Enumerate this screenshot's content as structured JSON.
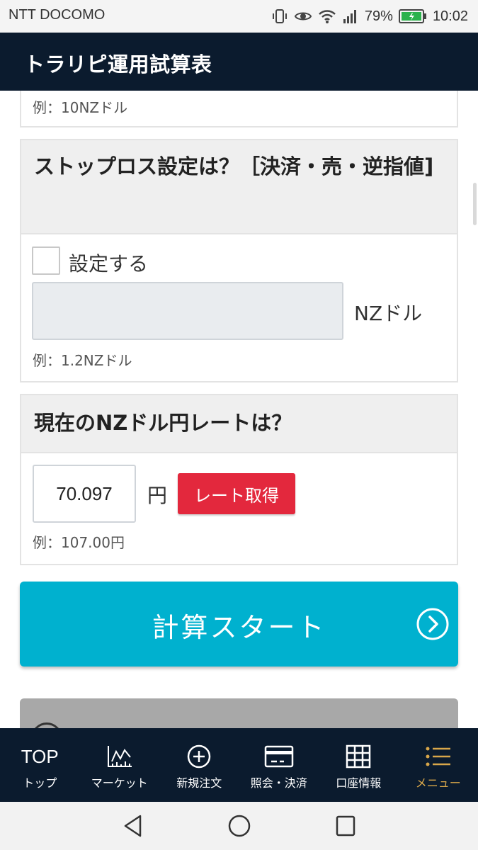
{
  "status_bar": {
    "carrier": "NTT DOCOMO",
    "battery_percent": "79%",
    "time": "10:02",
    "icons": [
      "vibrate-icon",
      "eye-icon",
      "wifi-icon",
      "signal-icon",
      "battery-icon"
    ]
  },
  "header": {
    "title": "トラリピ運用試算表"
  },
  "prev_card": {
    "hint": "例：10NZドル"
  },
  "stop_loss": {
    "title": "ストップロス設定は？［決済・売・逆指値]",
    "checkbox_label": "設定する",
    "checkbox_checked": false,
    "input_value": "",
    "unit": "NZドル",
    "hint": "例：1.2NZドル"
  },
  "rate": {
    "title": "現在のNZドル円レートは？",
    "input_value": "70.097",
    "unit": "円",
    "button_label": "レート取得",
    "hint": "例：107.00円"
  },
  "start_button": {
    "label": "計算スタート",
    "icon": "chevron-right-circle-icon"
  },
  "bottom_nav": [
    {
      "label": "トップ",
      "icon_text": "TOP",
      "icon": "top-icon",
      "active": false
    },
    {
      "label": "マーケット",
      "icon": "chart-icon",
      "active": false
    },
    {
      "label": "新規注文",
      "icon": "plus-circle-icon",
      "active": false
    },
    {
      "label": "照会・決済",
      "icon": "card-icon",
      "active": false
    },
    {
      "label": "口座情報",
      "icon": "grid-icon",
      "active": false
    },
    {
      "label": "メニュー",
      "icon": "menu-icon",
      "active": true
    }
  ],
  "colors": {
    "header_bg": "#0b1b2e",
    "accent_cyan": "#00b1cf",
    "button_red": "#e3283d",
    "active_nav": "#d9a74a"
  }
}
